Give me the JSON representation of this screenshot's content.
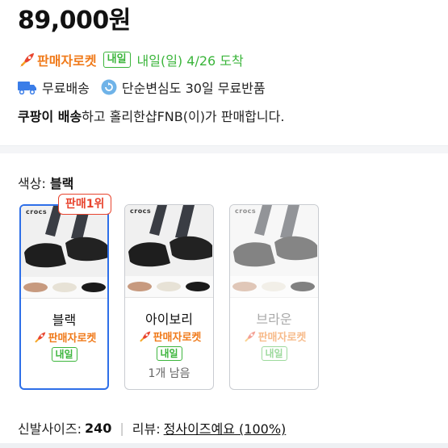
{
  "price": "89,000원",
  "delivery": {
    "rocket_label": "판매자로켓",
    "tomorrow_badge": "내일",
    "arrival": "내일(일) 4/26 도착"
  },
  "shipping": {
    "free_shipping": "무료배송",
    "return_policy": "단순변심도 30일 무료반품"
  },
  "seller": {
    "prefix": "쿠팡이 배송",
    "suffix": "하고 홀리한샵FNB(이)가 판매합니다."
  },
  "color_option": {
    "label": "색상:",
    "selected": "블랙"
  },
  "rank_badge": "판매1위",
  "brand_mark": "crocs",
  "options": [
    {
      "name": "블랙",
      "rocket": "판매자로켓",
      "tomorrow": "내일",
      "stock": ""
    },
    {
      "name": "아이보리",
      "rocket": "판매자로켓",
      "tomorrow": "내일",
      "stock": "1개 남음"
    },
    {
      "name": "브라운",
      "rocket": "판매자로켓",
      "tomorrow": "내일",
      "stock": ""
    }
  ],
  "size_review": {
    "size_label": "신발사이즈:",
    "size_value": "240",
    "separator": "|",
    "review_label": "리뷰:",
    "review_value": "정사이즈예요 (100%)"
  },
  "colors": {
    "rocket_orange": "#f07a1a",
    "tomorrow_green": "#3bb53b",
    "selected_blue": "#2e6fe8",
    "rank_red": "#e8442e"
  },
  "icons": {
    "rocket": "rocket-icon",
    "truck": "truck-icon",
    "return": "return-icon"
  }
}
